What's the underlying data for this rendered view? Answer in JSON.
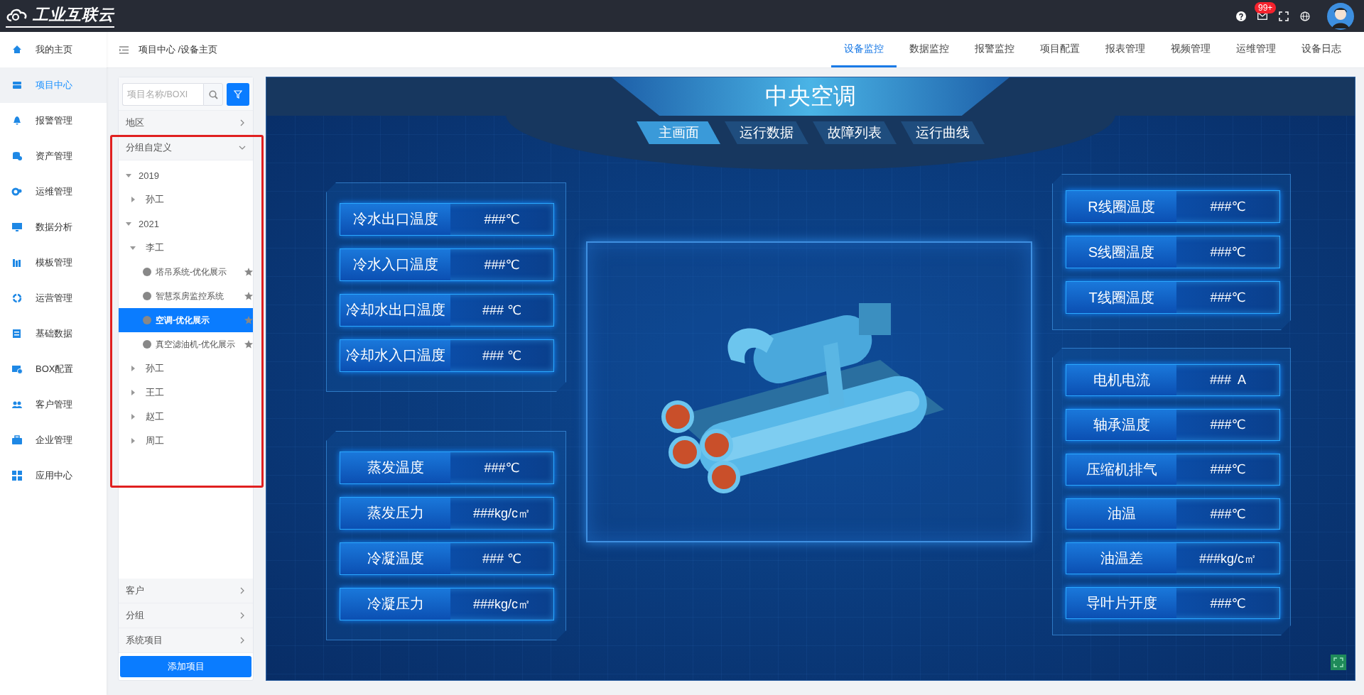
{
  "logo": {
    "text": "工业互联云"
  },
  "top_bar": {
    "mail_badge": "99+"
  },
  "sidebar": {
    "items": [
      {
        "label": "我的主页",
        "selected": false
      },
      {
        "label": "项目中心",
        "selected": true
      },
      {
        "label": "报警管理",
        "selected": false
      },
      {
        "label": "资产管理",
        "selected": false
      },
      {
        "label": "运维管理",
        "selected": false
      },
      {
        "label": "数据分析",
        "selected": false
      },
      {
        "label": "模板管理",
        "selected": false
      },
      {
        "label": "运营管理",
        "selected": false
      },
      {
        "label": "基础数据",
        "selected": false
      },
      {
        "label": "BOX配置",
        "selected": false
      },
      {
        "label": "客户管理",
        "selected": false
      },
      {
        "label": "企业管理",
        "selected": false
      },
      {
        "label": "应用中心",
        "selected": false
      }
    ]
  },
  "breadcrumb": "项目中心 /设备主页",
  "tabs": [
    {
      "label": "设备监控",
      "selected": true
    },
    {
      "label": "数据监控",
      "selected": false
    },
    {
      "label": "报警监控",
      "selected": false
    },
    {
      "label": "项目配置",
      "selected": false
    },
    {
      "label": "报表管理",
      "selected": false
    },
    {
      "label": "视频管理",
      "selected": false
    },
    {
      "label": "运维管理",
      "selected": false
    },
    {
      "label": "设备日志",
      "selected": false
    }
  ],
  "tree_panel": {
    "search": {
      "placeholder": "项目名称/BOXI"
    },
    "sections": [
      {
        "label": "地区",
        "expanded": false
      },
      {
        "label": "分组自定义",
        "expanded": true,
        "highlighted": true,
        "tree": [
          {
            "kind": "group",
            "label": "2019",
            "expanded": true,
            "children": [
              {
                "kind": "group",
                "label": "孙工",
                "expanded": false
              }
            ]
          },
          {
            "kind": "group",
            "label": "2021",
            "expanded": true,
            "children": [
              {
                "kind": "group",
                "label": "李工",
                "expanded": true,
                "children": [
                  {
                    "kind": "project",
                    "label": "塔吊系统-优化展示",
                    "selected": false
                  },
                  {
                    "kind": "project",
                    "label": "智慧泵房监控系统",
                    "selected": false
                  },
                  {
                    "kind": "project",
                    "label": "空调-优化展示",
                    "selected": true
                  },
                  {
                    "kind": "project",
                    "label": "真空滤油机-优化展示",
                    "selected": false
                  }
                ]
              },
              {
                "kind": "group",
                "label": "孙工",
                "expanded": false
              },
              {
                "kind": "group",
                "label": "王工",
                "expanded": false
              },
              {
                "kind": "group",
                "label": "赵工",
                "expanded": false
              },
              {
                "kind": "group",
                "label": "周工",
                "expanded": false
              }
            ]
          }
        ]
      },
      {
        "label": "客户",
        "expanded": false
      },
      {
        "label": "分组",
        "expanded": false
      },
      {
        "label": "系统项目",
        "expanded": false
      }
    ],
    "add_button": "添加项目"
  },
  "dashboard": {
    "title": "中央空调",
    "tabs": [
      {
        "label": "主画面",
        "selected": true
      },
      {
        "label": "运行数据",
        "selected": false
      },
      {
        "label": "故障列表",
        "selected": false
      },
      {
        "label": "运行曲线",
        "selected": false
      }
    ],
    "left_panels": [
      {
        "readouts": [
          {
            "label": "冷水出口温度",
            "value": "###℃"
          },
          {
            "label": "冷水入口温度",
            "value": "###℃"
          },
          {
            "label": "冷却水出口温度",
            "value": "### ℃"
          },
          {
            "label": "冷却水入口温度",
            "value": "### ℃"
          }
        ]
      },
      {
        "readouts": [
          {
            "label": "蒸发温度",
            "value": "###℃"
          },
          {
            "label": "蒸发压力",
            "value": "###kg/c㎡"
          },
          {
            "label": "冷凝温度",
            "value": "### ℃"
          },
          {
            "label": "冷凝压力",
            "value": "###kg/c㎡"
          }
        ]
      }
    ],
    "right_panels": [
      {
        "readouts": [
          {
            "label": "R线圈温度",
            "value": "###℃"
          },
          {
            "label": "S线圈温度",
            "value": "###℃"
          },
          {
            "label": "T线圈温度",
            "value": "###℃"
          }
        ]
      },
      {
        "readouts": [
          {
            "label": "电机电流",
            "value": "###  A"
          },
          {
            "label": "轴承温度",
            "value": "###℃"
          },
          {
            "label": "压缩机排气",
            "value": "###℃"
          },
          {
            "label": "油温",
            "value": "###℃"
          },
          {
            "label": "油温差",
            "value": "###kg/c㎡"
          },
          {
            "label": "导叶片开度",
            "value": "###℃"
          }
        ]
      }
    ]
  }
}
